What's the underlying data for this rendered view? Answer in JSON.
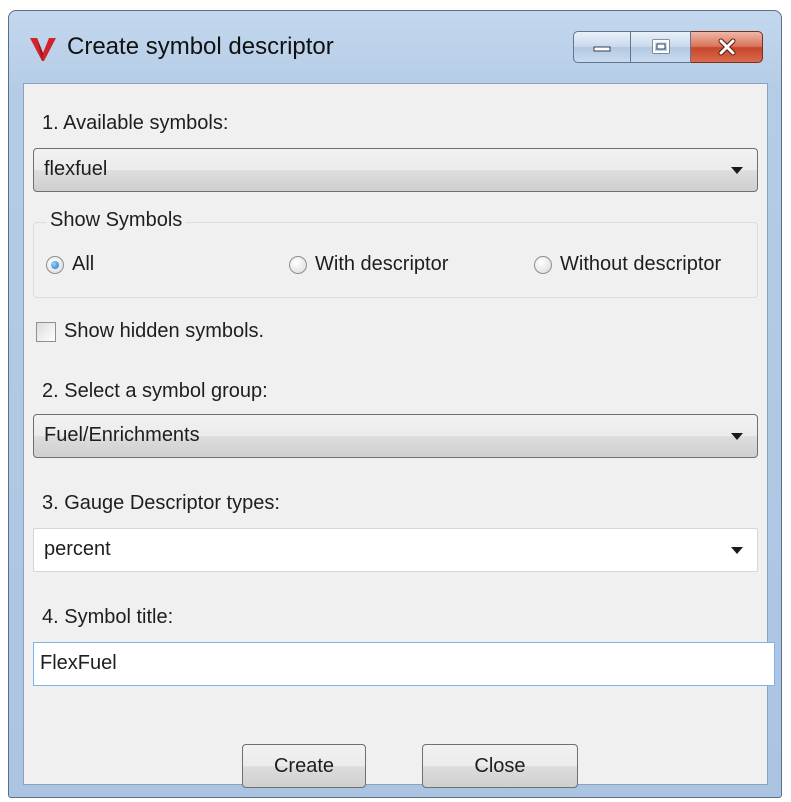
{
  "window": {
    "title": "Create symbol descriptor",
    "icon": "v-logo-icon",
    "controls": [
      "minimize-icon",
      "maximize-icon",
      "close-icon"
    ],
    "close_color": "#c8452a"
  },
  "available_symbols": {
    "label": "1. Available symbols:",
    "selected": "flexfuel"
  },
  "show_symbols": {
    "legend": "Show Symbols",
    "options": [
      "All",
      "With descriptor",
      "Without descriptor"
    ],
    "selected": "All"
  },
  "show_hidden": {
    "label": "Show hidden symbols.",
    "checked": false
  },
  "symbol_group": {
    "label": "2. Select a symbol group:",
    "selected": "Fuel/Enrichments"
  },
  "gauge_types": {
    "label": "3. Gauge Descriptor types:",
    "selected": "percent"
  },
  "symbol_title": {
    "label": "4. Symbol title:",
    "value": "FlexFuel"
  },
  "buttons": {
    "create": "Create",
    "close": "Close"
  }
}
